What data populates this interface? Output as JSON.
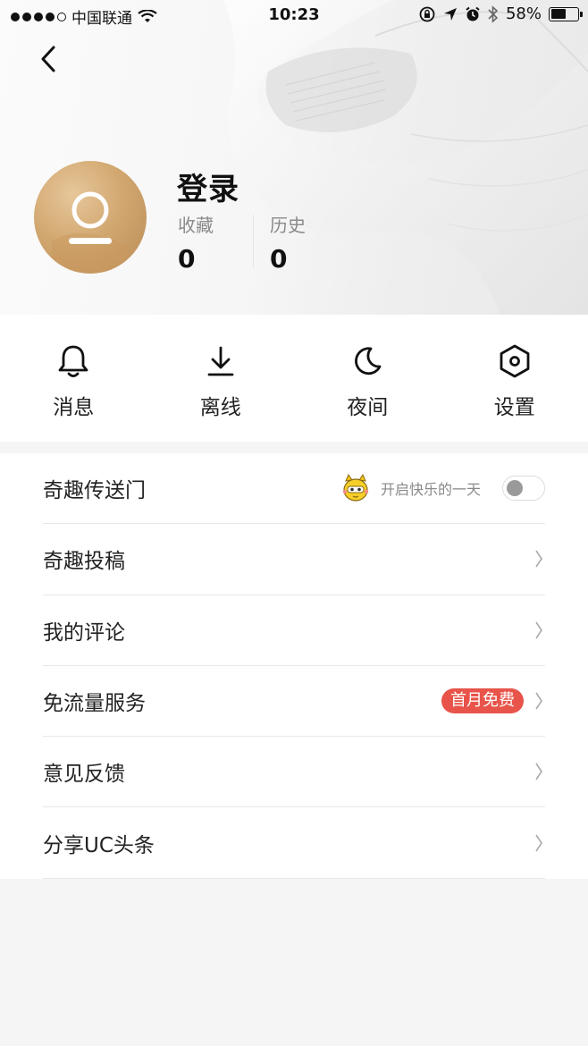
{
  "status_bar": {
    "carrier": "中国联通",
    "time": "10:23",
    "battery": "58%",
    "battery_level": 0.58
  },
  "header": {
    "back_icon": "chevron-left-icon",
    "login_label": "登录",
    "stats": [
      {
        "label": "收藏",
        "value": "0"
      },
      {
        "label": "历史",
        "value": "0"
      }
    ]
  },
  "actions": [
    {
      "label": "消息",
      "icon": "bell-icon"
    },
    {
      "label": "离线",
      "icon": "download-icon"
    },
    {
      "label": "夜间",
      "icon": "moon-icon"
    },
    {
      "label": "设置",
      "icon": "hexagon-gear-icon"
    }
  ],
  "menu": {
    "portal": {
      "label": "奇趣传送门",
      "tagline": "开启快乐的一天",
      "toggle_on": false
    },
    "items": [
      {
        "label": "奇趣投稿"
      },
      {
        "label": "我的评论"
      },
      {
        "label": "免流量服务",
        "badge": "首月免费"
      },
      {
        "label": "意见反馈"
      },
      {
        "label": "分享UC头条"
      }
    ]
  },
  "colors": {
    "badge": "#e8544a",
    "text": "#222222",
    "muted": "#8a8a8a"
  }
}
